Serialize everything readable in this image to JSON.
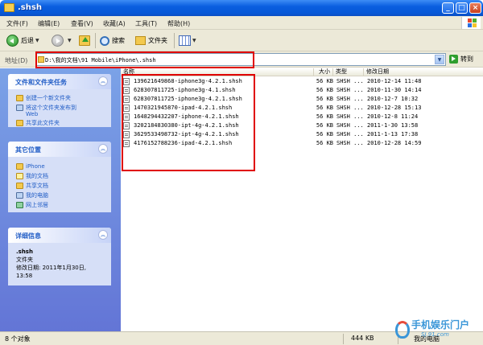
{
  "window": {
    "title": ".shsh",
    "controls": [
      "_",
      "□",
      "×"
    ]
  },
  "menu": [
    "文件(F)",
    "编辑(E)",
    "查看(V)",
    "收藏(A)",
    "工具(T)",
    "帮助(H)"
  ],
  "toolbar": {
    "back_label": "后退",
    "search_label": "搜索",
    "folders_label": "文件夹"
  },
  "address": {
    "label": "地址(D)",
    "value": "D:\\我的文档\\91 Mobile\\iPhone\\.shsh",
    "go_label": "转到"
  },
  "tasks": {
    "title": "文件和文件夹任务",
    "items": [
      "创建一个新文件夹",
      "将这个文件夹发布到",
      "Web",
      "共享此文件夹"
    ]
  },
  "other_places": {
    "title": "其它位置",
    "items": [
      "iPhone",
      "我的文档",
      "共享文档",
      "我的电脑",
      "网上邻居"
    ]
  },
  "details": {
    "title": "详细信息",
    "name": ".shsh",
    "type": "文件夹",
    "modified_label": "修改日期: 2011年1月30日,",
    "modified_time": "13:58"
  },
  "columns": {
    "name": "名称",
    "size": "大小",
    "type": "类型",
    "modified": "修改日期"
  },
  "files": [
    {
      "name": "139621649868-iphone3g-4.2.1.shsh",
      "size": "56 KB",
      "type": "SHSH ...",
      "date": "2010-12-14 11:48"
    },
    {
      "name": "628307811725-iphone3g-4.1.shsh",
      "size": "56 KB",
      "type": "SHSH ...",
      "date": "2010-11-30 14:14"
    },
    {
      "name": "628307811725-iphone3g-4.2.1.shsh",
      "size": "56 KB",
      "type": "SHSH ...",
      "date": "2010-12-7 10:32"
    },
    {
      "name": "1470321945870-ipad-4.2.1.shsh",
      "size": "56 KB",
      "type": "SHSH ...",
      "date": "2010-12-28 15:13"
    },
    {
      "name": "1648294432207-iphone-4.2.1.shsh",
      "size": "56 KB",
      "type": "SHSH ...",
      "date": "2010-12-8 11:24"
    },
    {
      "name": "3202184830380-ipt-4g-4.2.1.shsh",
      "size": "56 KB",
      "type": "SHSH ...",
      "date": "2011-1-30 13:58"
    },
    {
      "name": "3629533498732-ipt-4g-4.2.1.shsh",
      "size": "56 KB",
      "type": "SHSH ...",
      "date": "2011-1-13 17:38"
    },
    {
      "name": "4176152788236-ipad-4.2.1.shsh",
      "size": "56 KB",
      "type": "SHSH ...",
      "date": "2010-12-28 14:59"
    }
  ],
  "status": {
    "count": "8 个对象",
    "size": "444 KB",
    "location": "我的电脑"
  },
  "watermark": {
    "brand": "手机娱乐门户",
    "url": "SJ.91.com"
  }
}
